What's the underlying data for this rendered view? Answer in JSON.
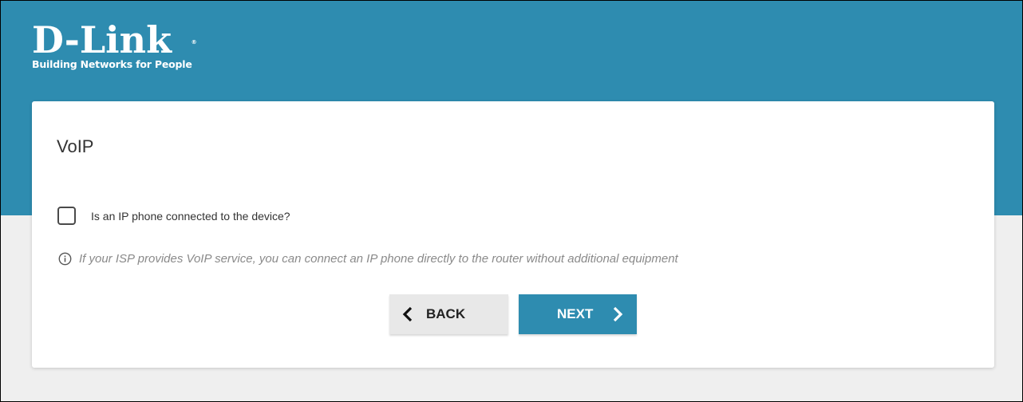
{
  "brand": {
    "name": "D-Link",
    "registered_mark": "®",
    "tagline": "Building Networks for People"
  },
  "page": {
    "title": "VoIP"
  },
  "ip_phone": {
    "label": "Is an IP phone connected to the device?",
    "checked": false
  },
  "info": {
    "icon": "info-circle-icon",
    "text": "If your ISP provides VoIP service, you can connect an IP phone directly to the router without additional equipment"
  },
  "buttons": {
    "back_label": "BACK",
    "back_icon": "chevron-left-icon",
    "next_label": "NEXT",
    "next_icon": "chevron-right-icon"
  },
  "colors": {
    "brand_blue": "#2e8cb0",
    "background": "#efefef",
    "card": "#ffffff"
  }
}
